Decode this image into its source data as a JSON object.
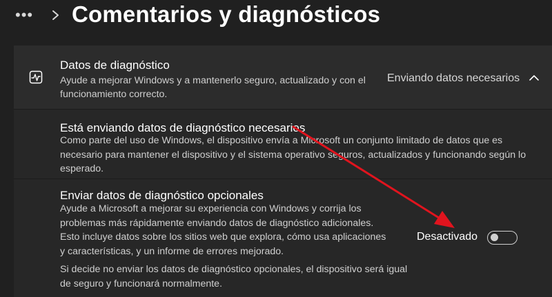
{
  "header": {
    "more_icon": "more-horizontal-icon",
    "chevron_icon": "chevron-right-icon",
    "title": "Comentarios y diagnósticos"
  },
  "diagnostic_data": {
    "icon": "diagnostic-pulse-icon",
    "title": "Datos de diagnóstico",
    "description": "Ayude a mejorar Windows y a mantenerlo seguro, actualizado y con el funcionamiento correcto.",
    "status": "Enviando datos necesarios",
    "expand_icon": "chevron-up-icon"
  },
  "required_section": {
    "title": "Está enviando datos de diagnóstico necesarios",
    "description": "Como parte del uso de Windows, el dispositivo envía a Microsoft un conjunto limitado de datos que es necesario para mantener el dispositivo y el sistema operativo seguros, actualizados y funcionando según lo esperado."
  },
  "optional_section": {
    "title": "Enviar datos de diagnóstico opcionales",
    "description": "Ayude a Microsoft a mejorar su experiencia con Windows y corrija los problemas más rápidamente enviando datos de diagnóstico adicionales. Esto incluye datos sobre los sitios web que explora, cómo usa aplicaciones y características, y un informe de errores mejorado.",
    "note": "Si decide no enviar los datos de diagnóstico opcionales, el dispositivo será igual de seguro y funcionará normalmente.",
    "toggle_label": "Desactivado",
    "toggle_on": false
  },
  "colors": {
    "background": "#202020",
    "card": "#2b2b2b",
    "annotation_arrow": "#e0141e"
  }
}
